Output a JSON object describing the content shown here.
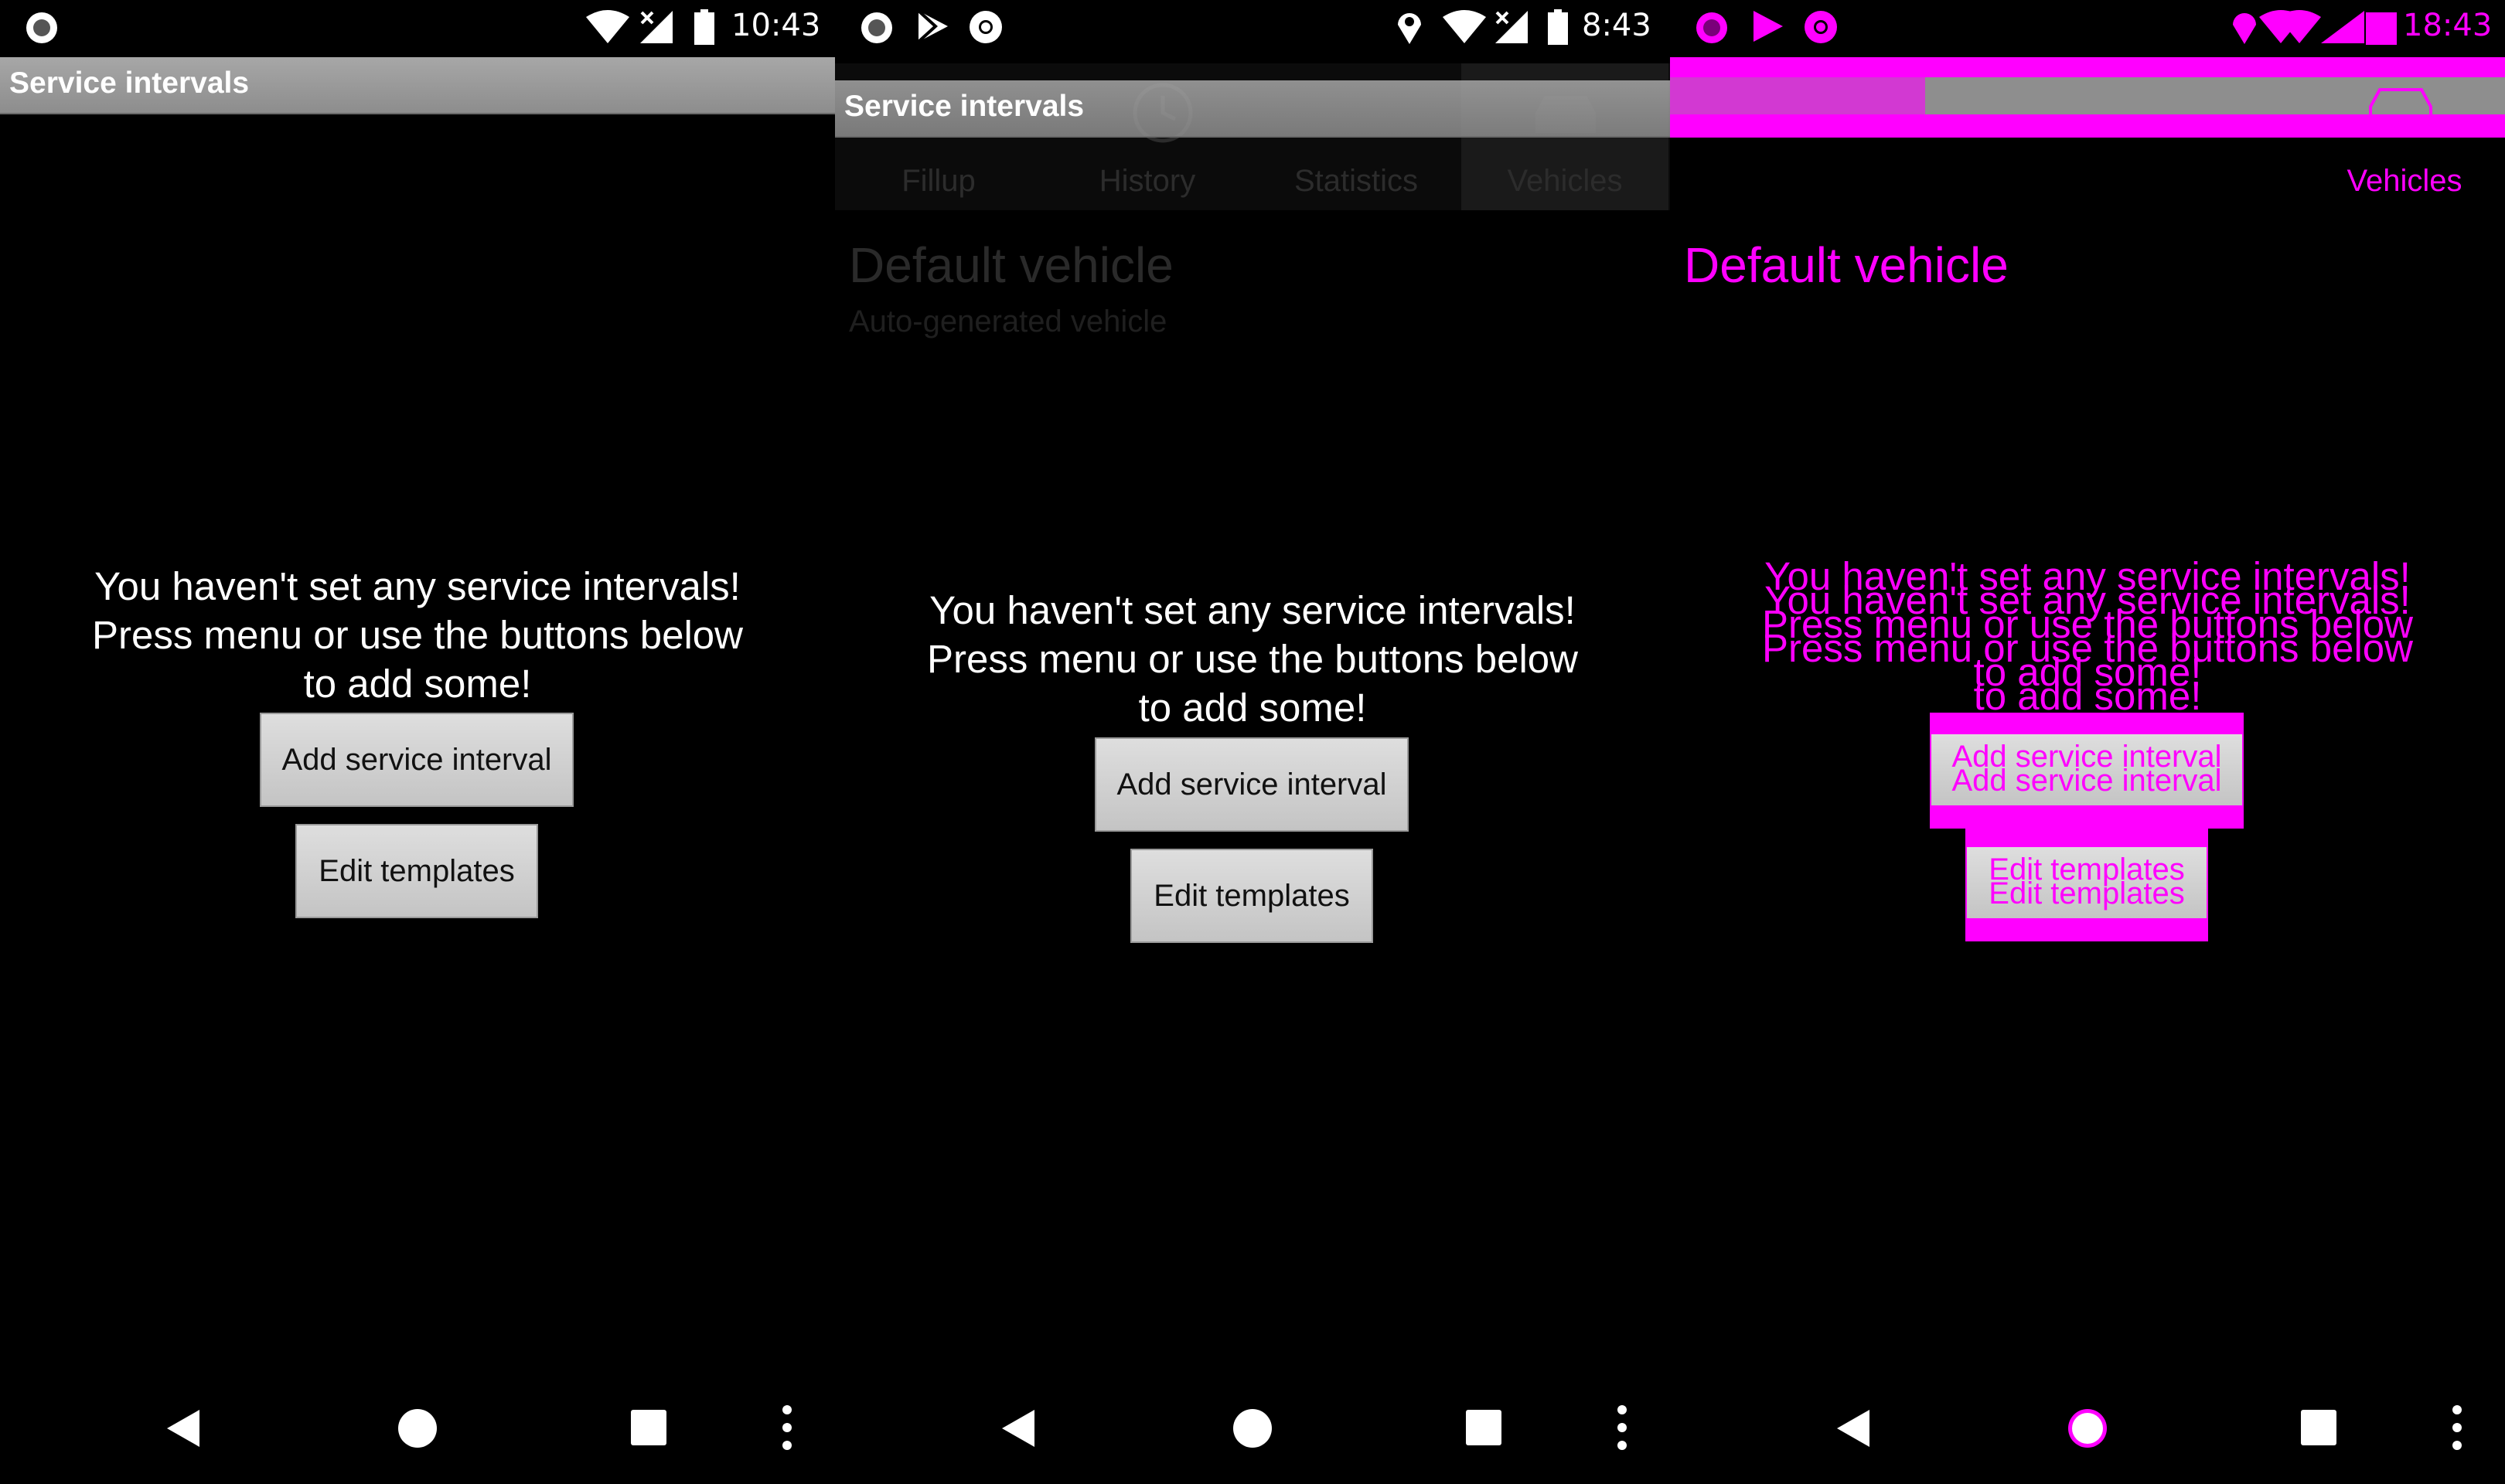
{
  "panels": [
    {
      "status": {
        "time": "10:43"
      },
      "actionbar": {
        "title": "Service intervals"
      },
      "message": {
        "line1": "You haven't set any service intervals!",
        "line2": "Press menu or use the buttons below",
        "line3": "to add some!"
      },
      "buttons": {
        "add": "Add service interval",
        "edit": "Edit templates"
      }
    },
    {
      "status": {
        "time": "8:43"
      },
      "actionbar": {
        "title": "Service intervals"
      },
      "tabs": [
        "Fillup",
        "History",
        "Statistics",
        "Vehicles"
      ],
      "vehicle": {
        "name": "Default vehicle",
        "subtitle": "Auto-generated vehicle"
      },
      "message": {
        "line1": "You haven't set any service intervals!",
        "line2": "Press menu or use the buttons below",
        "line3": "to add some!"
      },
      "buttons": {
        "add": "Add service interval",
        "edit": "Edit templates"
      }
    },
    {
      "status": {
        "time": "18:43"
      },
      "tab_vehicles": "Vehicles",
      "vehicle": {
        "name": "Default vehicle"
      },
      "message": {
        "line1": "You haven't set any service intervals!",
        "line2": "Press menu or use the buttons below",
        "line3": "to add some!"
      },
      "buttons": {
        "add": "Add service interval",
        "edit": "Edit templates"
      }
    }
  ],
  "colors": {
    "diff_highlight": "#ff00ff",
    "actionbar": "#9a9a9a",
    "button": "#d0d0d0"
  },
  "icons": [
    "circle-notification-icon",
    "wifi-icon",
    "signal-icon",
    "battery-icon",
    "play-store-icon",
    "chrome-icon",
    "location-icon",
    "back-icon",
    "home-icon",
    "recents-icon",
    "overflow-menu-icon",
    "car-icon"
  ]
}
